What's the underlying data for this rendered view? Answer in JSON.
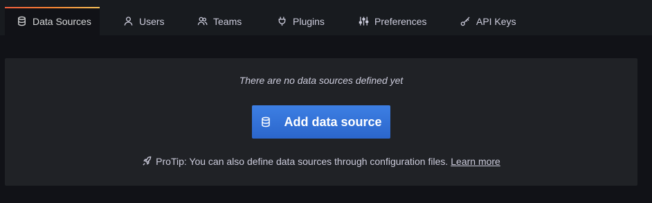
{
  "tabs": [
    {
      "label": "Data Sources",
      "icon": "database-icon",
      "active": true
    },
    {
      "label": "Users",
      "icon": "user-icon",
      "active": false
    },
    {
      "label": "Teams",
      "icon": "users-icon",
      "active": false
    },
    {
      "label": "Plugins",
      "icon": "plug-icon",
      "active": false
    },
    {
      "label": "Preferences",
      "icon": "sliders-icon",
      "active": false
    },
    {
      "label": "API Keys",
      "icon": "key-icon",
      "active": false
    }
  ],
  "empty_state": {
    "message": "There are no data sources defined yet",
    "button_label": "Add data source",
    "protip_text": "ProTip: You can also define data sources through configuration files.",
    "learn_more": "Learn more"
  },
  "colors": {
    "background": "#111217",
    "tabbar": "#181b1f",
    "panel": "#202226",
    "primary_button": "#3274d9",
    "active_tab_accent": "#f55f3e"
  }
}
